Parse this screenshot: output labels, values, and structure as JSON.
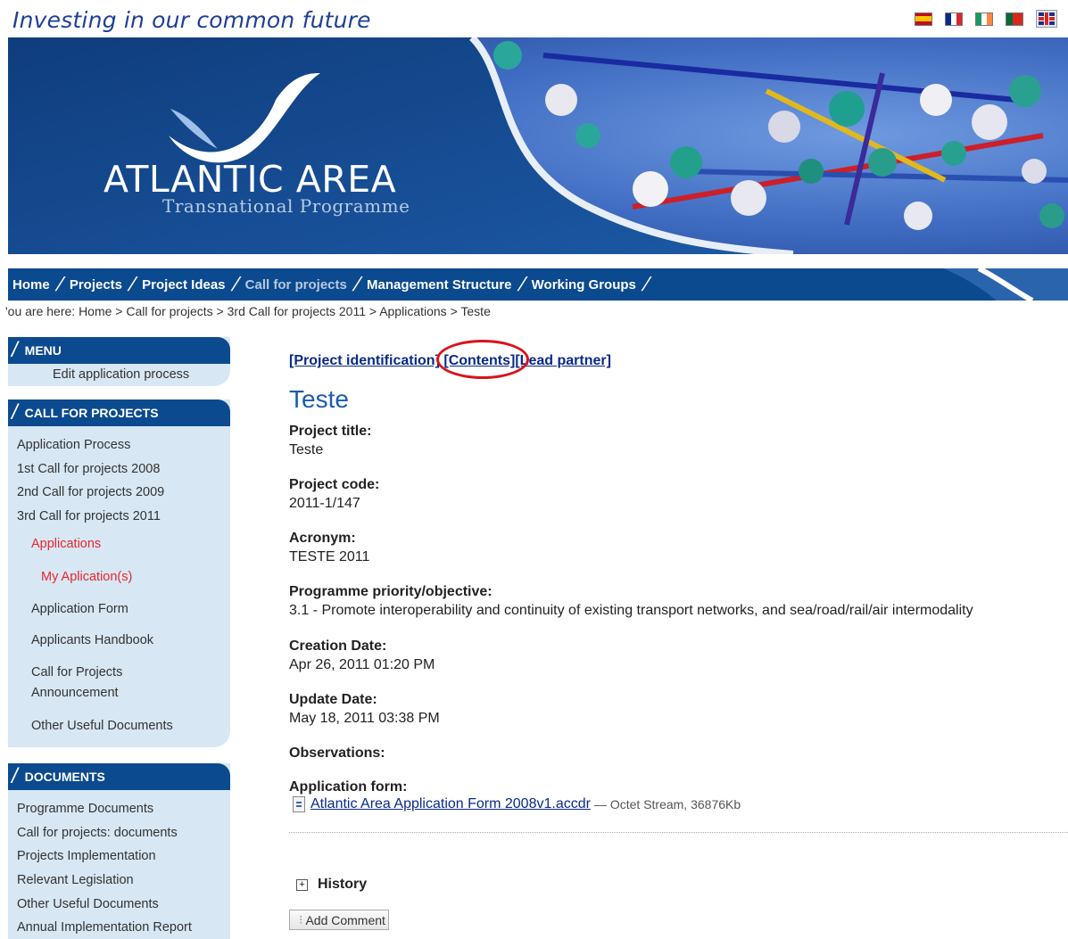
{
  "header": {
    "tagline": "Investing in our common future",
    "flags": [
      "spanish-flag-icon",
      "french-flag-icon",
      "irish-flag-icon",
      "portuguese-flag-icon",
      "uk-flag-icon"
    ]
  },
  "banner": {
    "brand": "ATLANTIC AREA",
    "subtitle": "Transnational Programme"
  },
  "nav": {
    "items": [
      {
        "label": "Home"
      },
      {
        "label": "Projects"
      },
      {
        "label": "Project Ideas"
      },
      {
        "label": "Call for projects"
      },
      {
        "label": "Management Structure"
      },
      {
        "label": "Working Groups"
      }
    ]
  },
  "breadcrumb": {
    "prefix": "'ou are here:",
    "items": [
      "Home",
      "Call for projects",
      "3rd Call for projects 2011",
      "Applications",
      "Teste"
    ]
  },
  "sidebar": {
    "menu": {
      "title": "MENU",
      "items": [
        "Edit application process"
      ]
    },
    "call": {
      "title": "CALL FOR PROJECTS",
      "items": [
        "Application Process",
        "1st Call for projects 2008",
        "2nd Call for projects 2009",
        "3rd Call for projects 2011",
        "Applications",
        "My Aplication(s)",
        "Application Form",
        "Applicants Handbook",
        "Call for Projects",
        "Announcement",
        "Other Useful Documents"
      ]
    },
    "documents": {
      "title": "DOCUMENTS",
      "items": [
        "Programme Documents",
        "Call for projects: documents",
        "Projects Implementation",
        "Relevant Legislation",
        "Other Useful Documents",
        "Annual Implementation Report"
      ]
    }
  },
  "main": {
    "tabs": [
      "[Project identification]",
      "[Contents]",
      "[Lead partner]"
    ],
    "title": "Teste",
    "fields": [
      {
        "label": "Project title:",
        "value": "Teste"
      },
      {
        "label": "Project code:",
        "value": "2011-1/147"
      },
      {
        "label": "Acronym:",
        "value": "TESTE 2011"
      },
      {
        "label": "Programme priority/objective:",
        "value": "3.1 - Promote interoperability and continuity of existing transport networks, and sea/road/rail/air intermodality"
      },
      {
        "label": "Creation Date:",
        "value": "Apr 26, 2011 01:20 PM"
      },
      {
        "label": "Update Date:",
        "value": "May 18, 2011 03:38 PM"
      },
      {
        "label": "Observations:",
        "value": ""
      },
      {
        "label": "Application form:",
        "value": ""
      }
    ],
    "file": {
      "name": "Atlantic Area Application Form 2008v1.accdr",
      "meta": "— Octet Stream, 36876Kb"
    },
    "history_label": "History",
    "add_comment_label": "Add Comment"
  },
  "colors": {
    "nav": "#0b4a8f",
    "sidebar_bg": "#d7e7f4",
    "link": "#0a2a8a",
    "active": "#e8262a",
    "title": "#1c5ca8",
    "annotation": "#d8141b"
  }
}
